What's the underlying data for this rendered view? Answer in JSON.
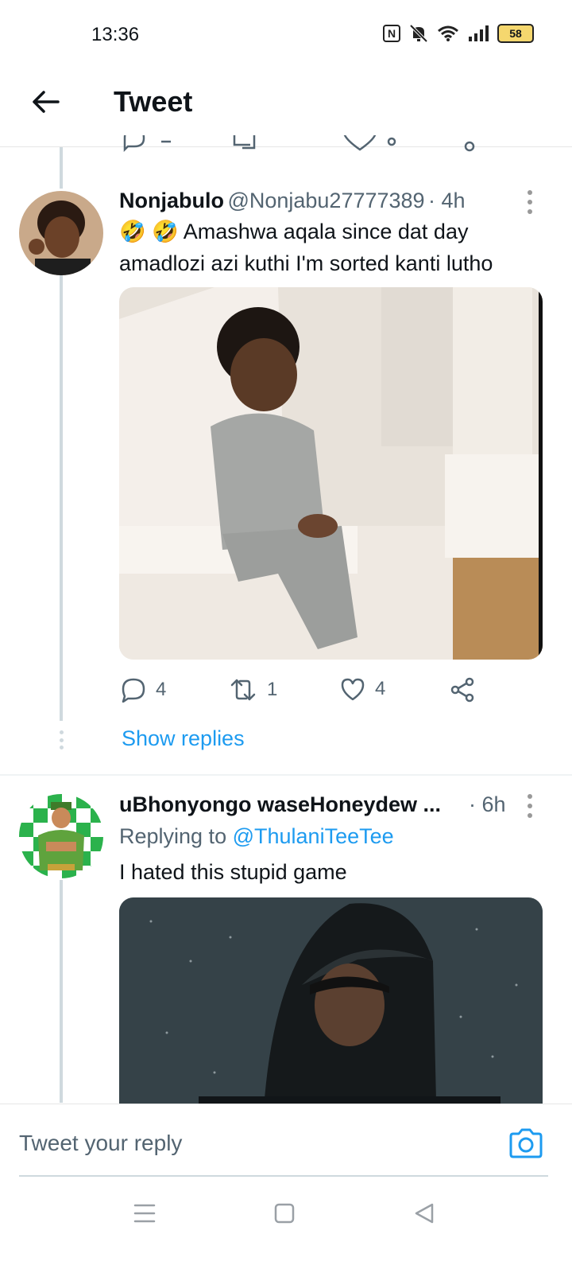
{
  "status_bar": {
    "time": "13:36",
    "battery": "58"
  },
  "header": {
    "title": "Tweet"
  },
  "tweet1": {
    "name": "Nonjabulo",
    "handle": "@Nonjabu27777389",
    "time": "· 4h",
    "text_line1": "🤣 🤣 Amashwa aqala since dat day",
    "text_line2": "amadlozi azi kuthi I'm sorted kanti lutho",
    "replies": "4",
    "retweets": "1",
    "likes": "4",
    "show_replies": "Show replies"
  },
  "tweet2": {
    "name": "uBhonyongo waseHoneydew ...",
    "time": "· 6h",
    "replying_label": "Replying to",
    "replying_handle": "@ThulaniTeeTee",
    "text": "I hated this stupid game"
  },
  "reply_bar": {
    "placeholder": "Tweet your reply"
  },
  "colors": {
    "accent": "#1d9bf0",
    "secondary_text": "#536471",
    "thread_line": "#cfd9de"
  }
}
